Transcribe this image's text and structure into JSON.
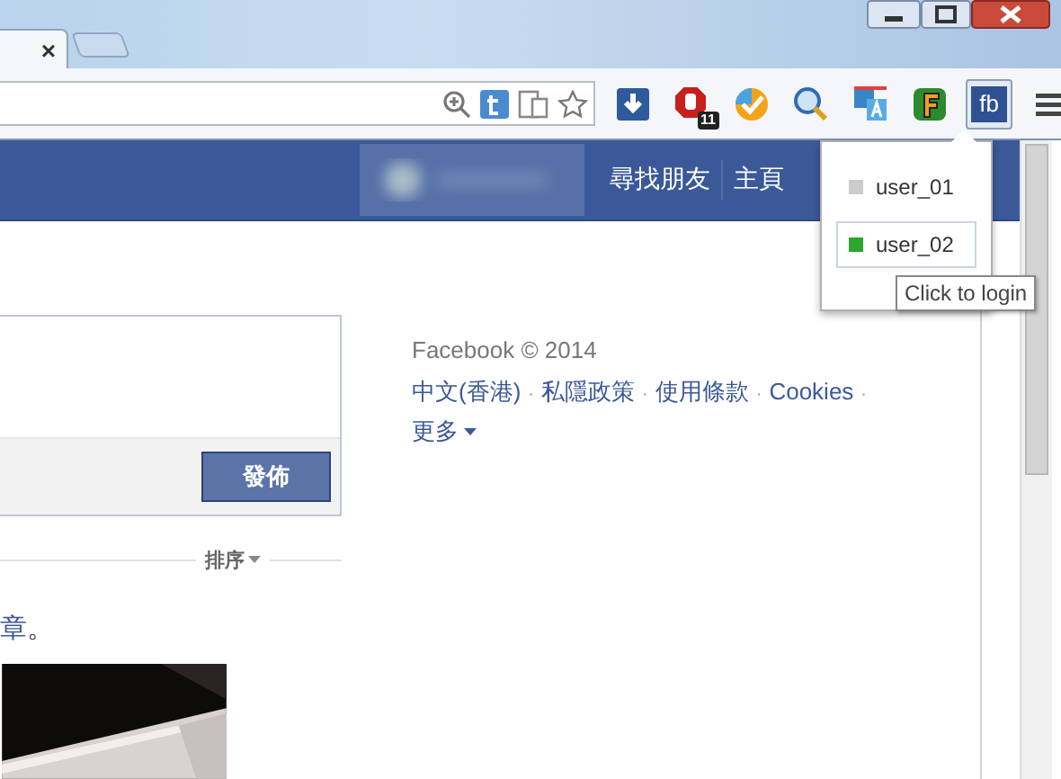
{
  "tab": {
    "close": "×"
  },
  "extensions": [
    {
      "kind": "download",
      "selected": false
    },
    {
      "kind": "stop",
      "badge": "11",
      "selected": false
    },
    {
      "kind": "check",
      "selected": false
    },
    {
      "kind": "magnifier",
      "selected": false
    },
    {
      "kind": "translate",
      "selected": false
    },
    {
      "kind": "letter",
      "selected": false
    },
    {
      "kind": "fb",
      "label": "fb",
      "selected": true
    }
  ],
  "nav": [
    "尋找朋友",
    "主頁"
  ],
  "accounts": [
    {
      "name": "user_01",
      "color": "#cccccc",
      "selected": false
    },
    {
      "name": "user_02",
      "color": "#2ca52c",
      "selected": true
    }
  ],
  "tooltip": "Click to login",
  "composer": {
    "button": "發佈"
  },
  "footer": {
    "copyright": "Facebook © 2014",
    "separator": "·",
    "links": [
      "中文(香港)",
      "私隱政策",
      "使用條款",
      "Cookies"
    ],
    "more": "更多"
  },
  "sort": "排序",
  "post": {
    "link": "章",
    "rest": "。"
  }
}
